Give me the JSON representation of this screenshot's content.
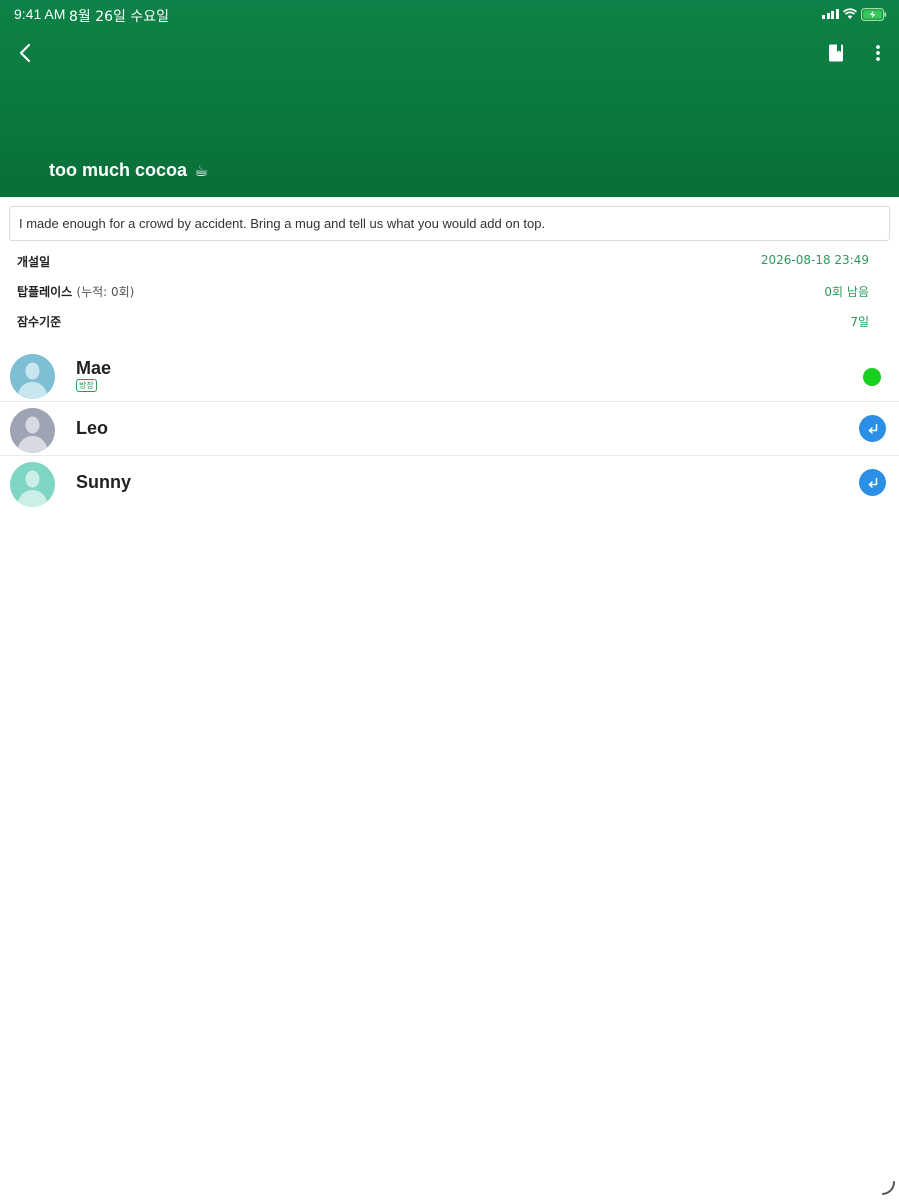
{
  "status_bar": {
    "time": "9:41 AM",
    "date": "8월 26일 수요일"
  },
  "header": {
    "title": "too much cocoa",
    "title_icon": "☕",
    "accent_color": "#0e8248"
  },
  "description": "I made enough for a crowd by accident. Bring a mug and tell us what you would add on top.",
  "info": {
    "created_label": "개설일",
    "created_value": "2026-08-18 23:49",
    "topplace_label": "탑플레이스",
    "topplace_sub": "(누적: 0회)",
    "topplace_value": "0회 남음",
    "dormant_label": "잠수기준",
    "dormant_value": "7일"
  },
  "members": [
    {
      "name": "Mae",
      "badge": "방장",
      "status": "online",
      "avatar_color": "#7fbfd6"
    },
    {
      "name": "Leo",
      "status": "enter",
      "avatar_color": "#9ea4b4"
    },
    {
      "name": "Sunny",
      "status": "enter",
      "avatar_color": "#7fd6c4"
    }
  ],
  "icons": {
    "back": "chevron-left-icon",
    "bookmark": "bookmark-icon",
    "more": "more-vertical-icon",
    "enter": "enter-arrow-icon"
  }
}
